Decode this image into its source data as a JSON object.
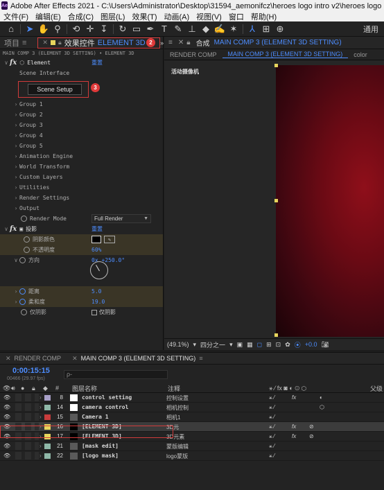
{
  "window": {
    "app_icon": "Ae",
    "title": "Adobe After Effects 2021 - C:\\Users\\Administrator\\Desktop\\31594_aemonifcz\\heroes logo intro v2\\heroes logo intro v2 (已修"
  },
  "menu": [
    "文件(F)",
    "编辑(E)",
    "合成(C)",
    "图层(L)",
    "效果(T)",
    "动画(A)",
    "视图(V)",
    "窗口",
    "帮助(H)"
  ],
  "toolbar": {
    "tools": [
      "home-icon",
      "selection-icon",
      "hand-icon",
      "zoom-icon",
      "orbit-icon",
      "pan-icon",
      "dolly-icon",
      "rotate-icon",
      "mask-rect-icon",
      "pen-icon",
      "type-icon",
      "brush-icon",
      "clone-icon",
      "eraser-icon",
      "roto-icon",
      "puppet-icon"
    ],
    "workspace_label": "通用"
  },
  "effect_controls": {
    "project_tab": "项目",
    "tab_label": "效果控件",
    "tab_target": "ELEMENT 3D",
    "subheader": "MAIN COMP 3 (ELEMENT 3D SETTING) • ELEMENT 3D",
    "element_label": "Element",
    "reset_label": "重置",
    "scene_interface_label": "Scene Interface",
    "scene_setup_button": "Scene Setup",
    "groups": [
      "Group 1",
      "Group 2",
      "Group 3",
      "Group 4",
      "Group 5",
      "Animation Engine",
      "World Transform",
      "Custom Layers",
      "Utilities",
      "Render Settings",
      "Output"
    ],
    "render_mode_label": "Render Mode",
    "render_mode_value": "Full Render",
    "shadow_label": "投影",
    "shadow_color_label": "阴影颜色",
    "opacity_label": "不透明度",
    "opacity_value": "60%",
    "direction_label": "方向",
    "direction_value": "0x +250.0°",
    "distance_label": "距离",
    "distance_value": "5.0",
    "softness_label": "柔和度",
    "softness_value": "19.0",
    "shadow_only_label": "仅阴影",
    "shadow_only_checkbox_label": "仅阴影"
  },
  "composition": {
    "comp_label": "合成",
    "comp_name": "MAIN COMP 3 (ELEMENT 3D SETTING)",
    "sub_tabs": [
      "RENDER COMP",
      "MAIN COMP 3 (ELEMENT 3D SETTING)",
      "color"
    ],
    "camera_label": "活动摄像机",
    "zoom": "(49.1%)",
    "resolution": "四分之一",
    "exposure": "+0.0"
  },
  "timeline": {
    "tabs": [
      "RENDER COMP",
      "MAIN COMP 3 (ELEMENT 3D SETTING)"
    ],
    "timecode": "0:00:15:15",
    "frame_info": "00466 (29.97 fps)",
    "search_placeholder": "ρ-",
    "columns": {
      "layer_name": "图层名称",
      "comment": "注释",
      "parent": "父级"
    },
    "layers": [
      {
        "num": "8",
        "name": "control setting",
        "comment": "控制设置",
        "color": "#a8a0c8",
        "thumb": "#ffffff"
      },
      {
        "num": "14",
        "name": "camera control",
        "comment": "相机控制",
        "color": "#8fb8a8",
        "thumb": "#ffffff"
      },
      {
        "num": "15",
        "name": "Camera 1",
        "comment": "相机1",
        "color": "#c83c3c",
        "thumb": "#5a5a5a"
      },
      {
        "num": "16",
        "name": "[ELEMENT 3D]",
        "comment": "3D元",
        "color": "#e7d55d",
        "thumb": "#000000",
        "selected": true
      },
      {
        "num": "17",
        "name": "[ELEMENT 3D]",
        "comment": "3D元素",
        "color": "#e7d55d",
        "thumb": "#000000"
      },
      {
        "num": "21",
        "name": "[mask edit]",
        "comment": "蒙版编辑",
        "color": "#8fb8a8",
        "thumb": "#5a5a5a"
      },
      {
        "num": "22",
        "name": "[logo mask]",
        "comment": "logo蒙版",
        "color": "#8fb8a8",
        "thumb": "#5a5a5a"
      }
    ]
  },
  "badges": [
    "1",
    "2",
    "3"
  ],
  "colors": {
    "accent": "#4d8dff",
    "highlight": "#d23b3b",
    "label_yellow": "#e7d55d"
  }
}
